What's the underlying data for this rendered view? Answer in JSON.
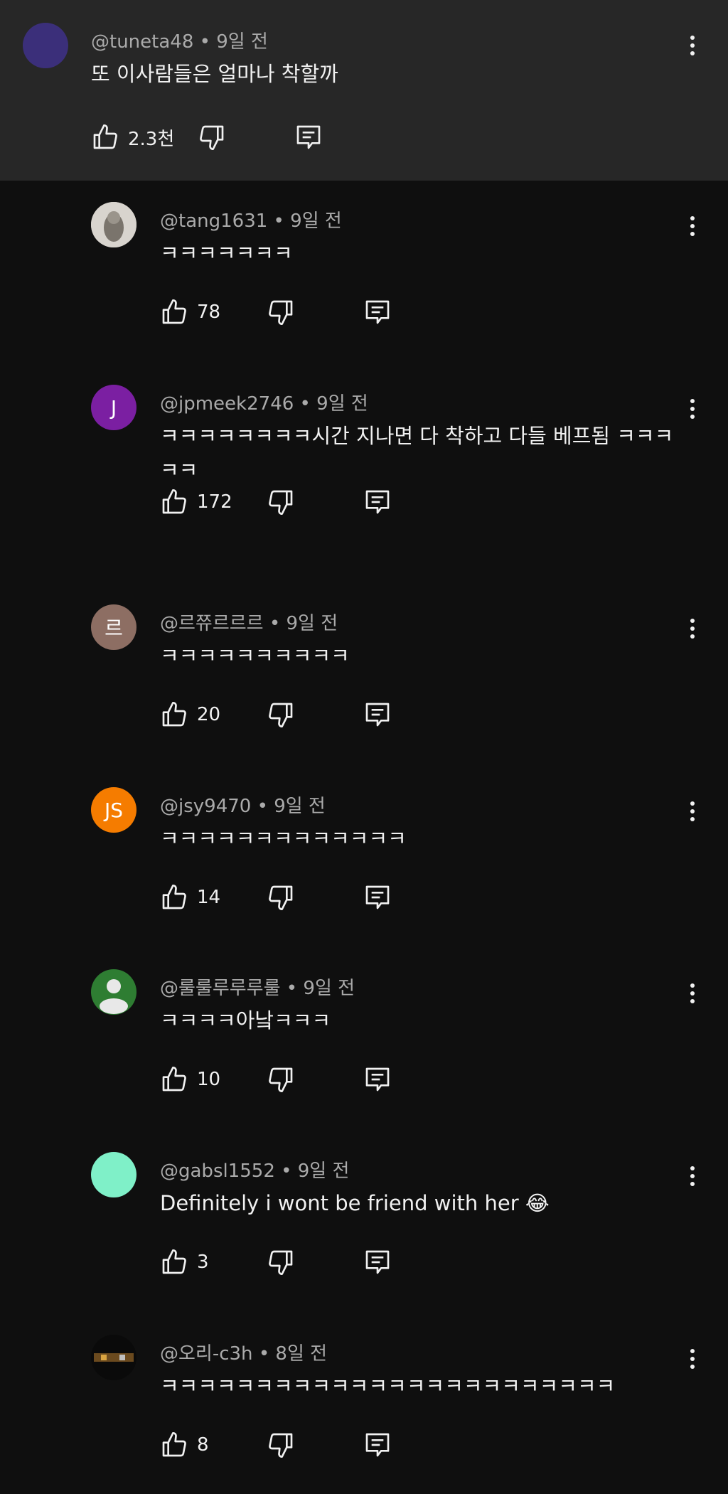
{
  "top_comment": {
    "author": "@tuneta48",
    "time": "9일 전",
    "text": "또 이사람들은 얼마나 착할까",
    "likes": "2.3천",
    "avatar_color": "#3b2f7a"
  },
  "replies": [
    {
      "author": "@tang1631",
      "time": "9일 전",
      "text": "ㅋㅋㅋㅋㅋㅋㅋ",
      "likes": "78",
      "avatar_letter": "",
      "avatar_color": "#b8b4ac",
      "avatar_icon": "dog-photo"
    },
    {
      "author": "@jpmeek2746",
      "time": "9일 전",
      "text": "ㅋㅋㅋㅋㅋㅋㅋㅋ시간 지나면 다 착하고 다들 베프됨 ㅋㅋㅋㅋㅋ",
      "likes": "172",
      "avatar_letter": "J",
      "avatar_color": "#7b1fa2"
    },
    {
      "author": "@르쮸르르르",
      "time": "9일 전",
      "text": "ㅋㅋㅋㅋㅋㅋㅋㅋㅋㅋ",
      "likes": "20",
      "avatar_letter": "르",
      "avatar_color": "#8d6e63"
    },
    {
      "author": "@jsy9470",
      "time": "9일 전",
      "text": "ㅋㅋㅋㅋㅋㅋㅋㅋㅋㅋㅋㅋㅋ",
      "likes": "14",
      "avatar_letter": "JS",
      "avatar_color": "#f57c00"
    },
    {
      "author": "@룰룰루루루룰",
      "time": "9일 전",
      "text": "ㅋㅋㅋㅋ아낰ㅋㅋㅋ",
      "likes": "10",
      "avatar_letter": "",
      "avatar_color": "#2e7d32",
      "avatar_icon": "person-icon"
    },
    {
      "author": "@gabsl1552",
      "time": "9일 전",
      "text": "Definitely i wont be friend with her 😂",
      "likes": "3",
      "avatar_letter": "",
      "avatar_color": "#7ff0c8"
    },
    {
      "author": "@오리-c3h",
      "time": "8일 전",
      "text": "ㅋㅋㅋㅋㅋㅋㅋㅋㅋㅋㅋㅋㅋㅋㅋㅋㅋㅋㅋㅋㅋㅋㅋㅋ",
      "likes": "8",
      "avatar_letter": "",
      "avatar_color": "#111111",
      "avatar_icon": "thumbnail-image"
    }
  ],
  "separator": "•"
}
